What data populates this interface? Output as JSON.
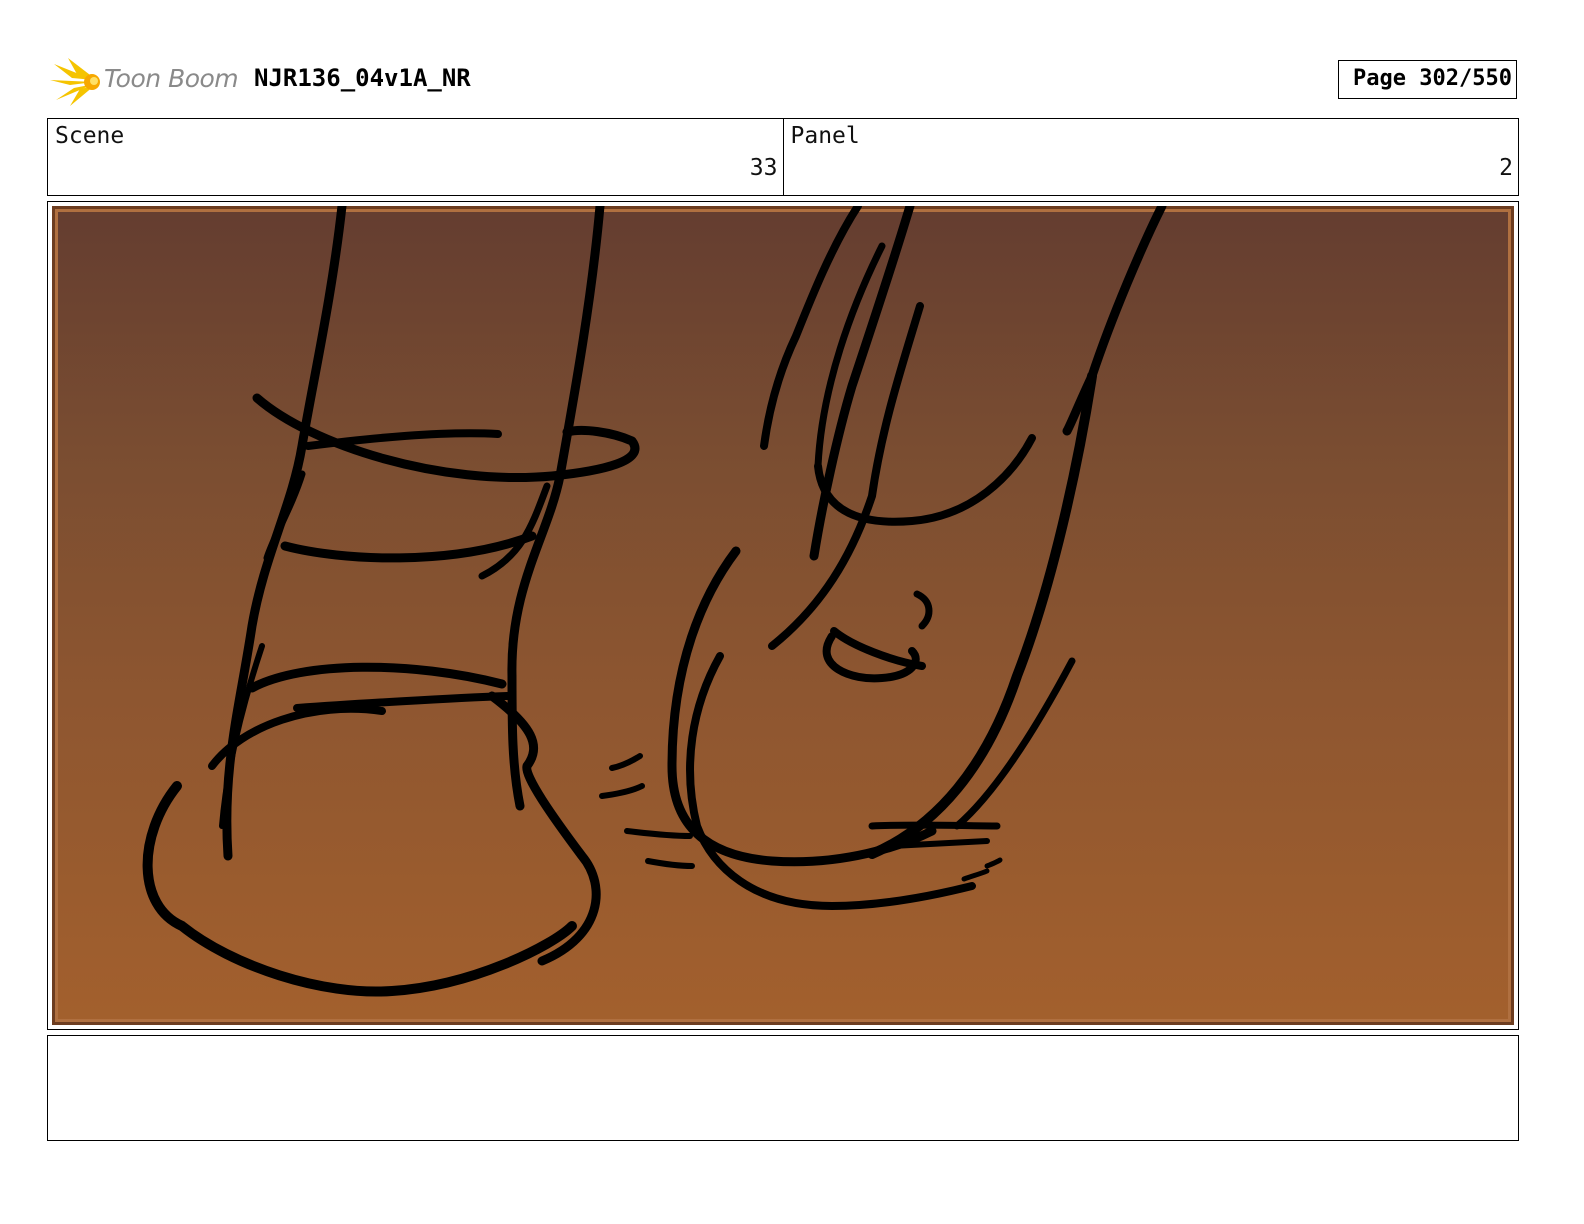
{
  "header": {
    "logo_text": "Toon Boom",
    "title": "NJR136_04v1A_NR",
    "page_label": "Page 302/550"
  },
  "panel_info": {
    "scene_label": "Scene",
    "scene_value": "33",
    "panel_label": "Panel",
    "panel_value": "2"
  },
  "artwork": {
    "background_top": "#643d30",
    "background_bottom": "#a3602d",
    "stroke_color": "#000000"
  },
  "notes": {
    "text": ""
  }
}
